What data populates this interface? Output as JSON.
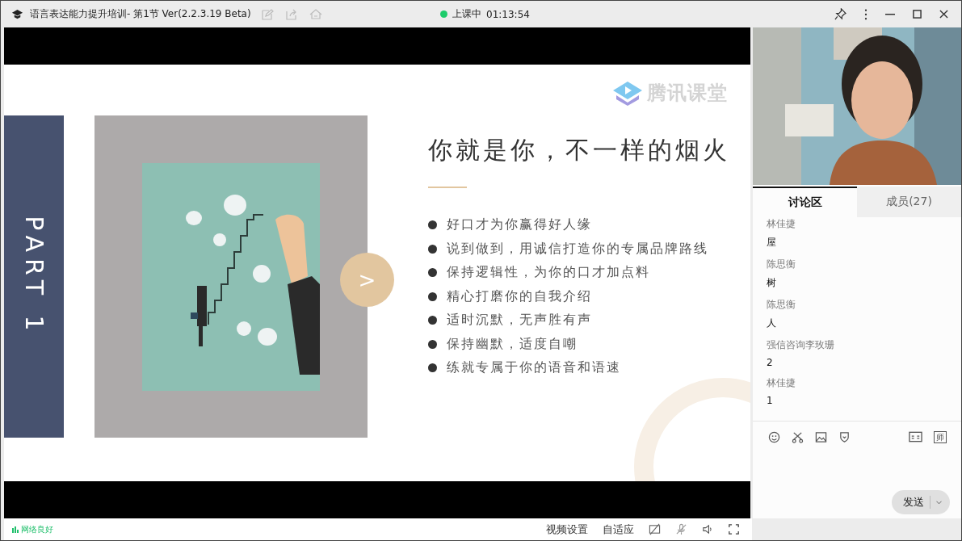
{
  "window": {
    "title": "语言表达能力提升培训- 第1节 Ver(2.2.3.19 Beta)",
    "status": "上课中",
    "timer": "01:13:54"
  },
  "slide": {
    "part_label": "PART 1",
    "next_button": ">",
    "logo": "腾讯课堂",
    "title": "你就是你，不一样的烟火",
    "bullets": [
      "好口才为你赢得好人缘",
      "说到做到，用诚信打造你的专属品牌路线",
      "保持逻辑性，为你的口才加点料",
      "精心打磨你的自我介绍",
      "适时沉默，无声胜有声",
      "保持幽默，适度自嘲",
      "练就专属于你的语音和语速"
    ]
  },
  "chat": {
    "tabs": [
      {
        "label": "讨论区",
        "selected": true
      },
      {
        "label": "成员(27)",
        "selected": false
      }
    ],
    "messages": [
      {
        "sender": "林佳捷",
        "text": "屋"
      },
      {
        "sender": "陈思衡",
        "text": "树"
      },
      {
        "sender": "陈思衡",
        "text": "人"
      },
      {
        "sender": "强信咨询李玫珊",
        "text": "2"
      },
      {
        "sender": "林佳捷",
        "text": "1"
      }
    ],
    "teacher_button": "师",
    "send_button": "发送"
  },
  "status_bar": {
    "network": "网络良好",
    "buttons": [
      "视频设置",
      "自适应"
    ]
  }
}
